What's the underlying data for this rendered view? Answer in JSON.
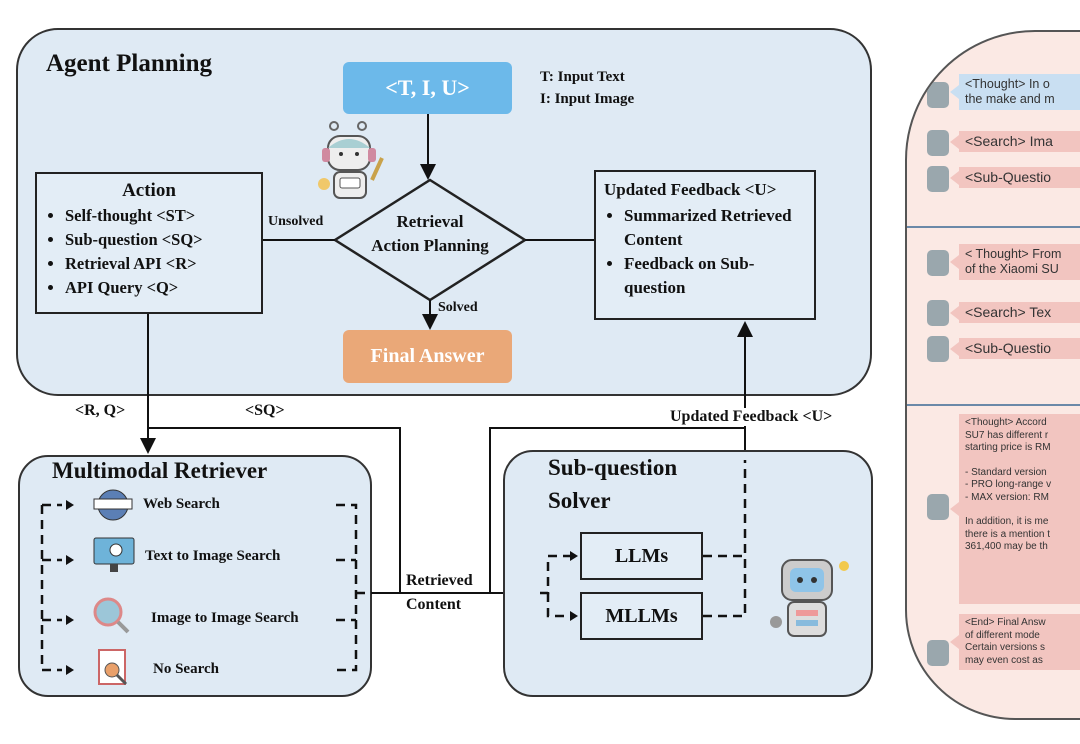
{
  "agent_planning": {
    "title": "Agent Planning",
    "input": "<T, I, U>",
    "legend": [
      "T: Input Text",
      "I: Input Image"
    ],
    "decision": [
      "Retrieval",
      "Action Planning"
    ],
    "unsolved": "Unsolved",
    "solved": "Solved",
    "final_answer": "Final Answer",
    "action": {
      "title": "Action",
      "items": [
        "Self-thought <ST>",
        "Sub-question <SQ>",
        "Retrieval API <R>",
        "API Query <Q>"
      ]
    },
    "feedback": {
      "title": "Updated Feedback <U>",
      "items": [
        "Summarized Retrieved Content",
        "Feedback on Sub-question"
      ]
    }
  },
  "connectors": {
    "rq": "<R, Q>",
    "sq": "<SQ>",
    "updated_feedback": "Updated Feedback <U>",
    "retrieved_content": [
      "Retrieved",
      "Content"
    ]
  },
  "retriever": {
    "title": "Multimodal Retriever",
    "items": [
      "Web Search",
      "Text to Image Search",
      "Image to Image Search",
      "No Search"
    ]
  },
  "solver": {
    "title": [
      "Sub-question",
      "Solver"
    ],
    "models": [
      "LLMs",
      "MLLMs"
    ]
  },
  "trace": {
    "step1": {
      "thought": [
        "<Thought> In o",
        "the make and m"
      ],
      "search": "<Search> Ima",
      "subq": "<Sub-Questio"
    },
    "step2": {
      "thought": [
        "< Thought> From",
        "of the Xiaomi SU"
      ],
      "search": "<Search> Tex",
      "subq": "<Sub-Questio"
    },
    "step3": {
      "thought": [
        "<Thought> Accord",
        "SU7 has different r",
        "starting price is RM",
        "",
        "- Standard version",
        "- PRO long-range v",
        "- MAX version: RM",
        "",
        "In addition, it is me",
        "there is a mention t",
        "361,400 may be th"
      ]
    },
    "end": [
      "<End> Final Answ",
      "of different mode",
      "Certain versions s",
      "may even cost as"
    ]
  },
  "colors": {
    "panel": "#dfeaf4",
    "input_box": "#6cb9ea",
    "final_box": "#eaa878",
    "trace_bg": "#fbe9e4",
    "bubble": "#f2c5c0",
    "bubble_blue": "#c9dff2"
  }
}
